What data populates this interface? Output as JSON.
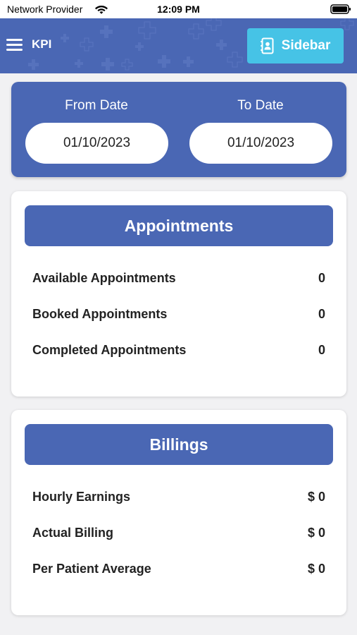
{
  "status_bar": {
    "carrier": "Network Provider",
    "time": "12:09 PM",
    "icons": [
      "wifi-icon",
      "battery-icon"
    ]
  },
  "header": {
    "title": "KPI",
    "sidebar_button_label": "Sidebar",
    "menu_icon": "hamburger-menu-icon",
    "sidebar_icon": "contact-book-icon",
    "background_color": "#4a67b4",
    "button_color": "#46c3e6"
  },
  "date_range": {
    "from_label": "From Date",
    "from_value": "01/10/2023",
    "to_label": "To Date",
    "to_value": "01/10/2023"
  },
  "appointments": {
    "title": "Appointments",
    "rows": [
      {
        "label": "Available Appointments",
        "value": "0"
      },
      {
        "label": "Booked Appointments",
        "value": "0"
      },
      {
        "label": "Completed Appointments",
        "value": "0"
      }
    ]
  },
  "billings": {
    "title": "Billings",
    "rows": [
      {
        "label": "Hourly Earnings",
        "value": "$ 0"
      },
      {
        "label": "Actual Billing",
        "value": "$ 0"
      },
      {
        "label": "Per Patient Average",
        "value": "$ 0"
      }
    ]
  }
}
